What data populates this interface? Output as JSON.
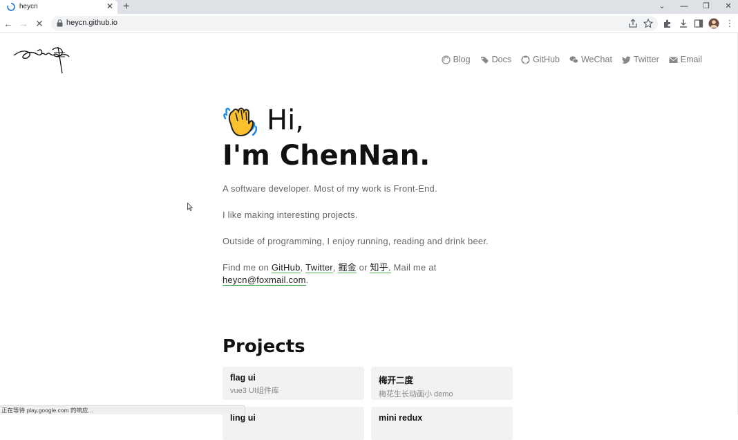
{
  "browser": {
    "tab_title": "heycn",
    "url": "heycn.github.io"
  },
  "nav": {
    "items": [
      {
        "label": "Blog",
        "icon": "blog-icon"
      },
      {
        "label": "Docs",
        "icon": "tags-icon"
      },
      {
        "label": "GitHub",
        "icon": "github-icon"
      },
      {
        "label": "WeChat",
        "icon": "wechat-icon"
      },
      {
        "label": "Twitter",
        "icon": "twitter-icon"
      },
      {
        "label": "Email",
        "icon": "envelope-icon"
      }
    ]
  },
  "hero": {
    "greeting": "Hi,",
    "name": "I'm ChenNan.",
    "p1": "A software developer. Most of my work is Front-End.",
    "p2": "I like making interesting projects.",
    "p3": "Outside of programming, I enjoy running, reading and drink beer.",
    "p4_prefix": "Find me on ",
    "link_github": "GitHub",
    "sep1": ", ",
    "link_twitter": "Twitter",
    "sep2": ", ",
    "link_juejin": "掘金",
    "sep3": " or ",
    "link_zhihu": "知乎.",
    "p4_mid": " Mail me at ",
    "email": "heycn@foxmail.com",
    "p4_suffix": "."
  },
  "projects": {
    "title": "Projects",
    "items": [
      {
        "name": "flag ui",
        "desc": "vue3 UI组件库"
      },
      {
        "name": "梅开二度",
        "desc": "梅花生长动画小 demo"
      },
      {
        "name": "ling ui",
        "desc": ""
      },
      {
        "name": "mini redux",
        "desc": ""
      }
    ]
  },
  "status_text": "正在等待 play.google.com 的响应...",
  "colors": {
    "link_underline": "#4caf50",
    "card_bg": "#f2f2f2",
    "text_muted": "#666666"
  }
}
